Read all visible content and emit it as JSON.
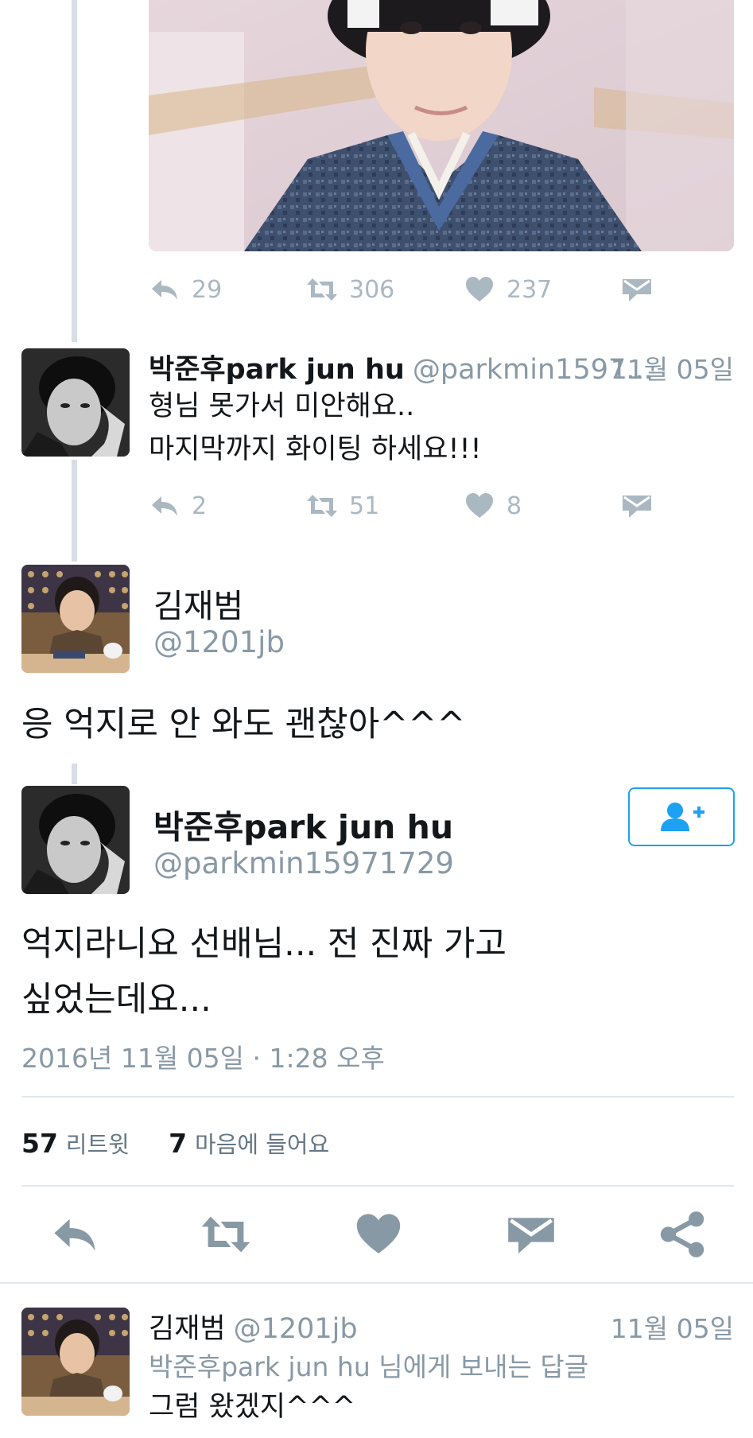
{
  "top_tweet": {
    "actions": {
      "reply_count": "29",
      "retweet_count": "306",
      "like_count": "237"
    }
  },
  "reply1": {
    "name": "박준후park jun hu",
    "handle": "@parkmin1597...",
    "date": "11월 05일",
    "lines": [
      "형님 못가서 미안해요..",
      "마지막까지 화이팅 하세요!!!"
    ],
    "actions": {
      "reply_count": "2",
      "retweet_count": "51",
      "like_count": "8"
    }
  },
  "parent": {
    "name": "김재범",
    "handle": "@1201jb",
    "text": "응 억지로 안 와도 괜찮아^^^"
  },
  "main": {
    "name": "박준후park jun hu",
    "handle": "@parkmin15971729",
    "lines": [
      "억지라니요 선배님... 전 진짜 가고",
      "싶었는데요..."
    ],
    "timestamp": "2016년 11월 05일 · 1:28 오후",
    "retweets": "57",
    "retweets_label": "리트윗",
    "likes": "7",
    "likes_label": "마음에 들어요"
  },
  "bottom_reply": {
    "name": "김재범",
    "handle": "@1201jb",
    "date": "11월 05일",
    "replying_to": "박준후park jun hu 님에게 보내는 답글",
    "text": "그럼 왔겠지^^^"
  },
  "icons": {
    "reply": "reply-icon",
    "retweet": "retweet-icon",
    "like": "heart-icon",
    "dm": "envelope-icon",
    "share": "share-icon",
    "follow": "add-user-icon"
  },
  "colors": {
    "accent": "#1da1f2",
    "muted": "#aab8c2",
    "text": "#14171a",
    "secondary": "#8899a6"
  }
}
